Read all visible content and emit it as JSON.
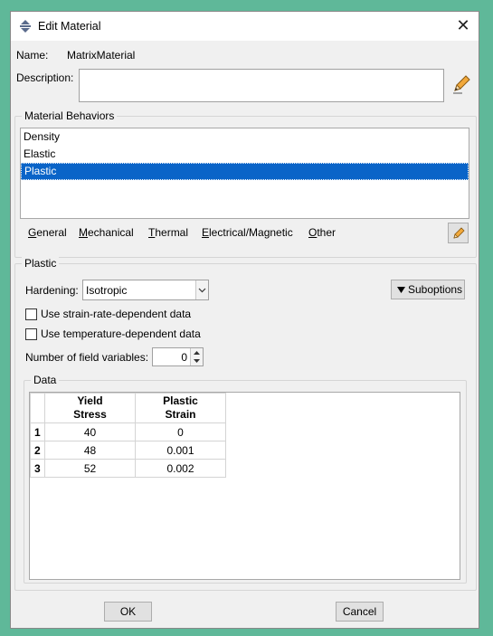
{
  "window": {
    "title": "Edit Material",
    "close_symbol": "✕"
  },
  "name": {
    "label": "Name:",
    "value": "MatrixMaterial"
  },
  "description": {
    "label": "Description:",
    "value": ""
  },
  "behaviors": {
    "group_title": "Material Behaviors",
    "items": [
      {
        "label": "Density",
        "selected": false
      },
      {
        "label": "Elastic",
        "selected": false
      },
      {
        "label": "Plastic",
        "selected": true
      }
    ],
    "menu": {
      "general": {
        "mn": "G",
        "rest": "eneral"
      },
      "mechanical": {
        "mn": "M",
        "rest": "echanical"
      },
      "thermal": {
        "mn": "T",
        "rest": "hermal"
      },
      "electrical": {
        "mn": "E",
        "rest": "lectrical/Magnetic"
      },
      "other": {
        "mn": "O",
        "rest": "ther"
      }
    }
  },
  "plastic": {
    "group_title": "Plastic",
    "hardening_label": "Hardening:",
    "hardening_value": "Isotropic",
    "suboptions_label": "Suboptions",
    "strain_rate_label": "Use strain-rate-dependent data",
    "strain_rate_checked": false,
    "temperature_label": "Use temperature-dependent data",
    "temperature_checked": false,
    "field_vars_label": "Number of field variables:",
    "field_vars_value": "0",
    "data_title": "Data",
    "table": {
      "col1_line1": "Yield",
      "col1_line2": "Stress",
      "col2_line1": "Plastic",
      "col2_line2": "Strain",
      "rows": [
        {
          "idx": "1",
          "stress": "40",
          "strain": "0"
        },
        {
          "idx": "2",
          "stress": "48",
          "strain": "0.001"
        },
        {
          "idx": "3",
          "stress": "52",
          "strain": "0.002"
        }
      ]
    }
  },
  "footer": {
    "ok_label": "OK",
    "cancel_label": "Cancel"
  },
  "colors": {
    "selection": "#0a64c8",
    "desktop": "#5fb899",
    "dialog": "#f0f0f0"
  }
}
